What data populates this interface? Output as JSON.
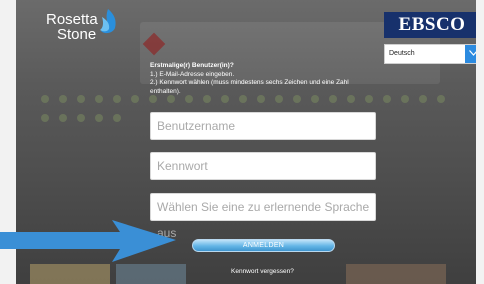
{
  "brand": {
    "logo_line1": "Rosetta",
    "logo_line2": "Stone",
    "partner": "EBSCO",
    "partner_color": "#17316c",
    "accent_color": "#2c8be0"
  },
  "language_select": {
    "selected": "Deutsch",
    "icon": "chevron-down-icon"
  },
  "instructions": {
    "title": "Erstmalige(r) Benutzer(in)?",
    "step1": "1.) E-Mail-Adresse eingeben.",
    "step2": "2.) Kennwort wählen (muss mindestens sechs Zeichen und eine Zahl enthalten)."
  },
  "form": {
    "username_placeholder": "Benutzername",
    "password_placeholder": "Kennwort",
    "language_placeholder": "Wählen Sie eine zu erlernende Sprache aus",
    "login_label": "ANMELDEN",
    "forgot_label": "Kennwort vergessen?"
  },
  "annotation": {
    "icon": "pointer-arrow-icon",
    "color": "#3a8fd6"
  }
}
